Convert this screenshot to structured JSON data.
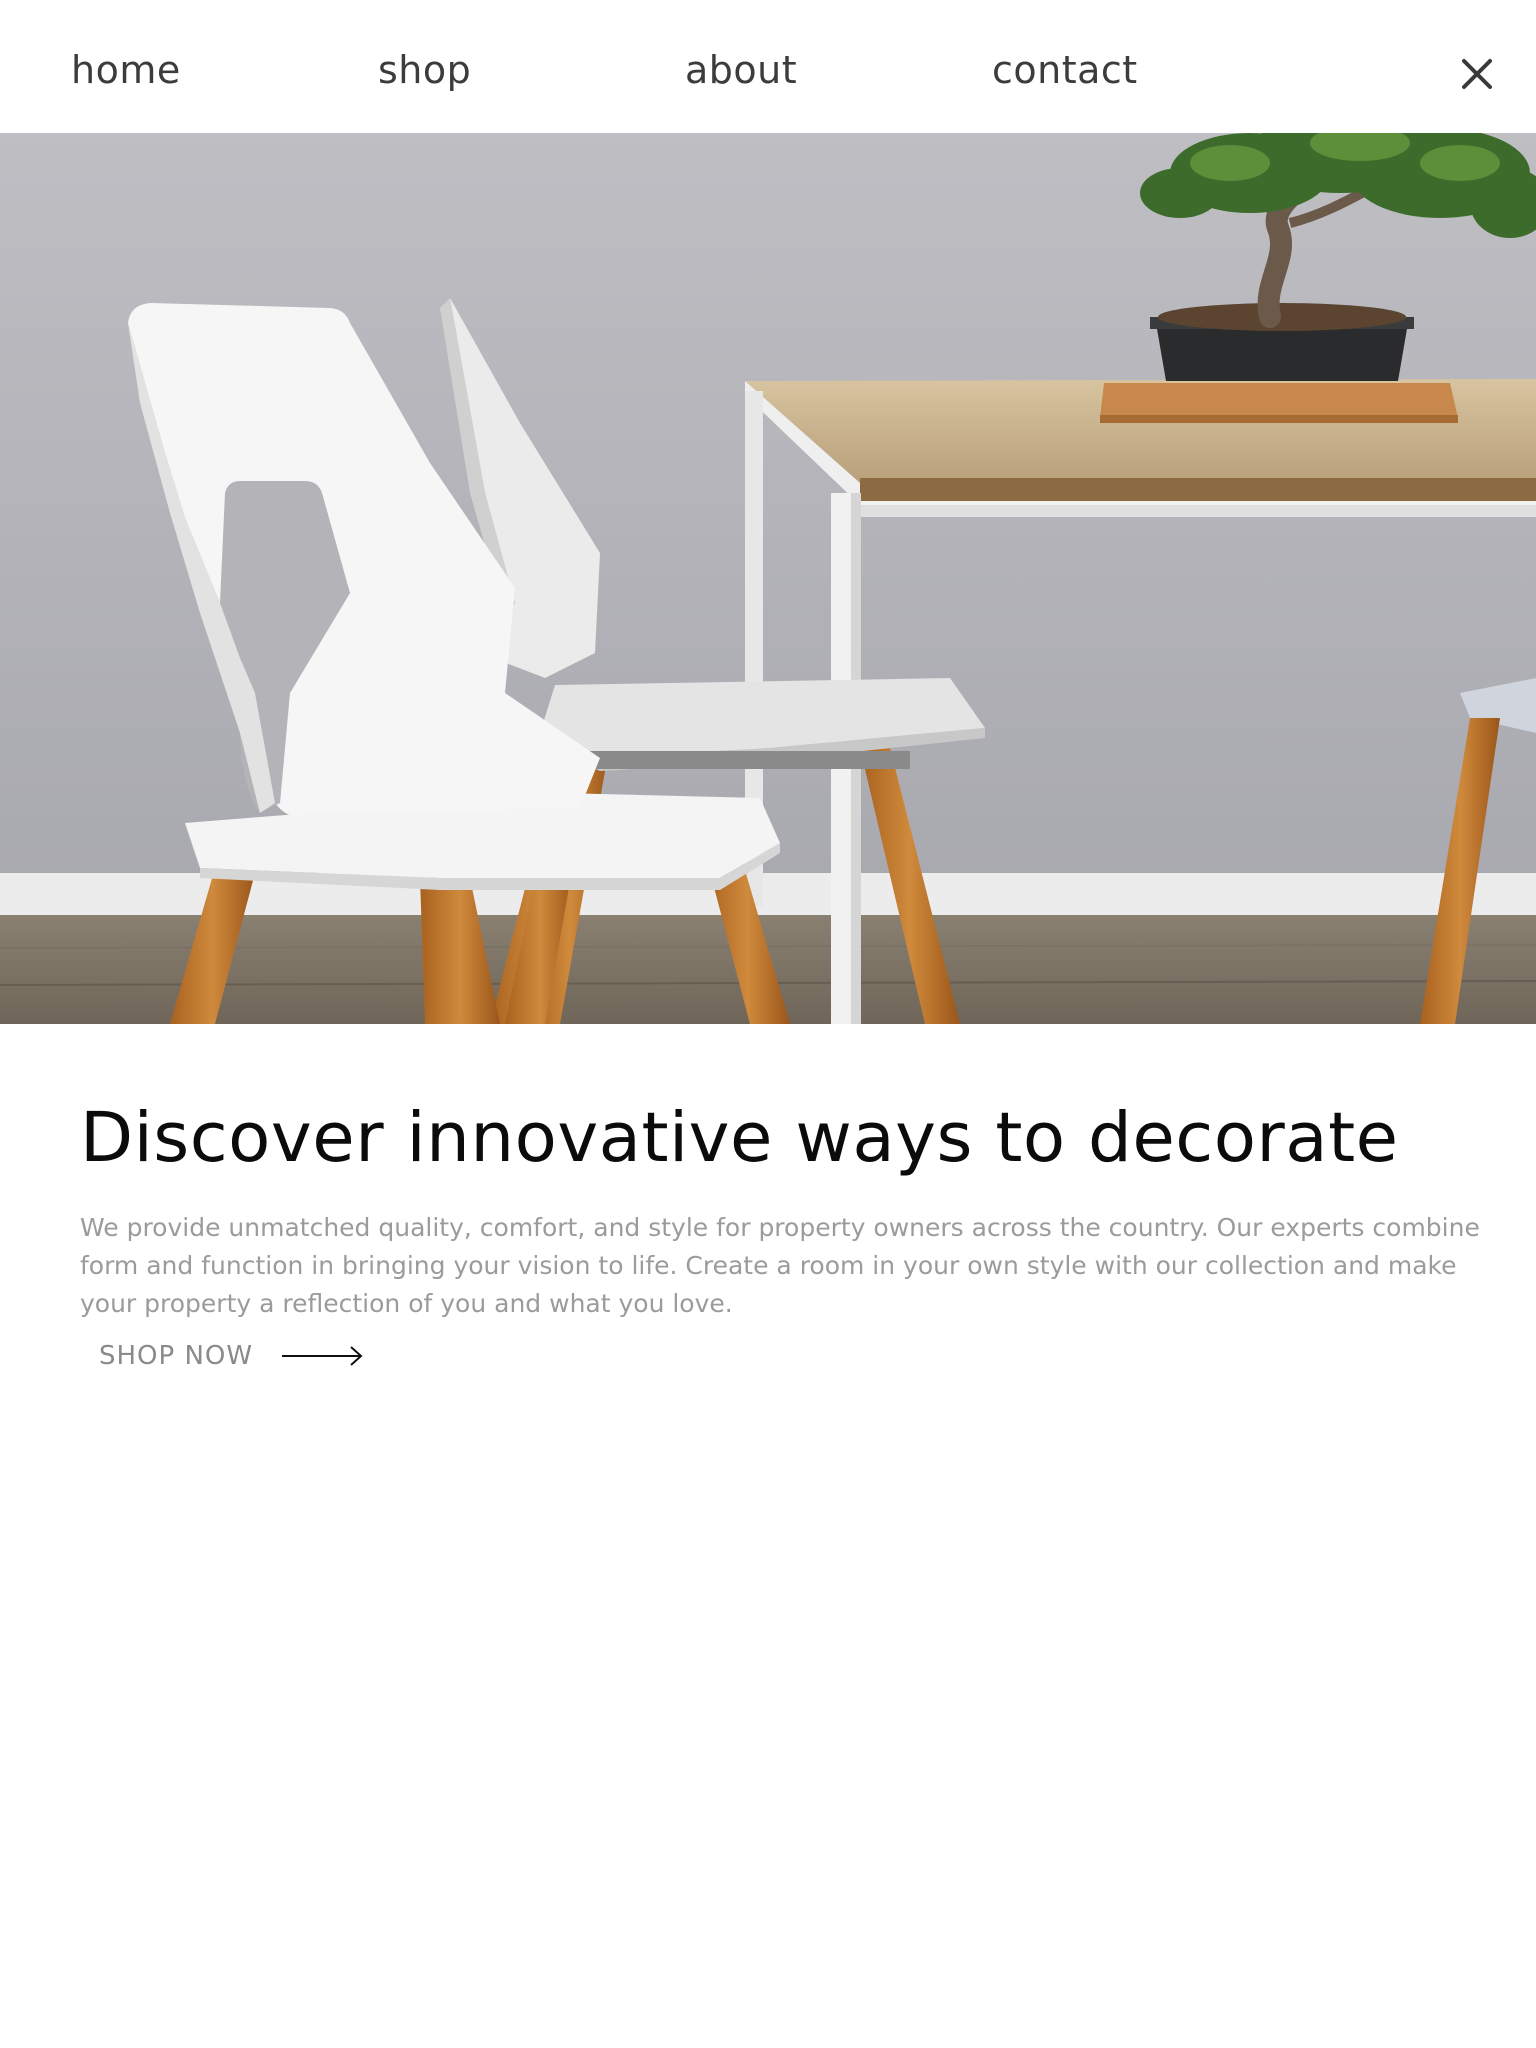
{
  "nav": {
    "items": [
      {
        "label": "home"
      },
      {
        "label": "shop"
      },
      {
        "label": "about"
      },
      {
        "label": "contact"
      }
    ],
    "close_icon": "close-icon"
  },
  "hero": {
    "image_subject": "white chairs with wooden legs beside a table with a bonsai tree"
  },
  "content": {
    "headline": "Discover innovative ways to decorate",
    "description": "We provide unmatched quality, comfort, and style for property owners across the country. Our experts combine form and function in bringing your vision to life. Create a room in your own style with our collection and make your property a reflection of you and what you love.",
    "cta_label": "SHOP NOW",
    "cta_icon": "arrow-right-icon"
  },
  "colors": {
    "nav_text": "#3c3c3c",
    "headline": "#0b0b0b",
    "body_text": "#9b9b9b",
    "cta_text": "#8a8a8a"
  }
}
